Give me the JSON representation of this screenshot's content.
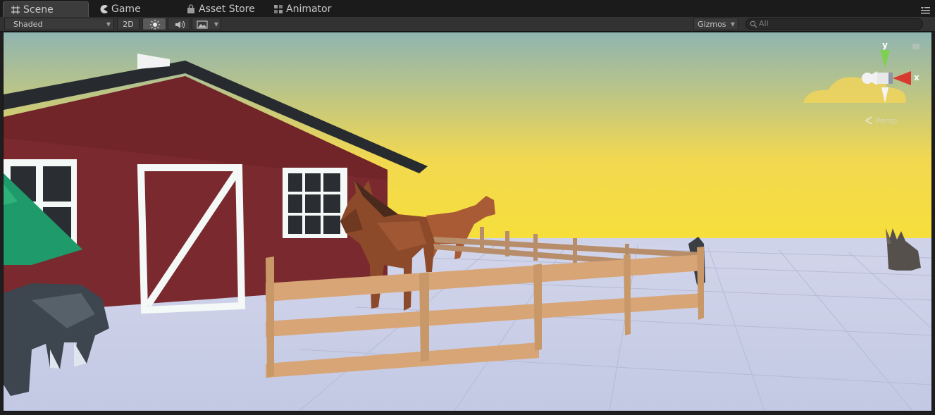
{
  "tabs": [
    {
      "label": "Scene",
      "icon": "scene-grid-icon",
      "active": true
    },
    {
      "label": "Game",
      "icon": "pacman-icon",
      "active": false
    },
    {
      "label": "Asset Store",
      "icon": "bag-icon",
      "active": false
    },
    {
      "label": "Animator",
      "icon": "animator-icon",
      "active": false
    }
  ],
  "toolbar": {
    "shading_mode": "Shaded",
    "mode_2d": "2D",
    "lighting_icon": "sun-icon",
    "audio_icon": "speaker-icon",
    "effects_icon": "image-icon",
    "gizmos": "Gizmos",
    "search_placeholder": "All"
  },
  "gizmo": {
    "y_label": "y",
    "x_label": "x",
    "projection_label": "Persp"
  },
  "colors": {
    "sky_top": "#8fb4b0",
    "sky_bottom": "#f6dc3a",
    "ground": "#c7cde6",
    "barn_red": "#7a2a2e",
    "roof": "#272b30",
    "fence": "#d8a577",
    "horse": "#8d4a2a"
  }
}
